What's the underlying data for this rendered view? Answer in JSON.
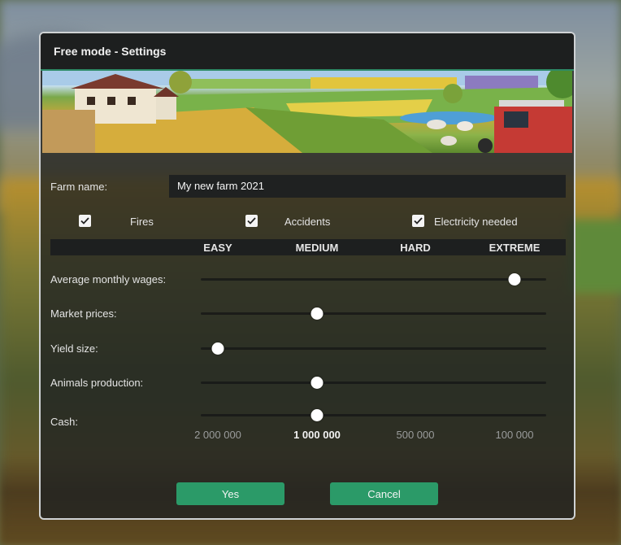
{
  "dialog": {
    "title": "Free mode - Settings"
  },
  "farm_name": {
    "label": "Farm name:",
    "value": "My new farm 2021"
  },
  "options": [
    {
      "label": "Fires",
      "checked": true
    },
    {
      "label": "Accidents",
      "checked": true
    },
    {
      "label": "Electricity needed",
      "checked": true
    }
  ],
  "difficulty_levels": [
    "EASY",
    "MEDIUM",
    "HARD",
    "EXTREME"
  ],
  "sliders": [
    {
      "label": "Average monthly wages:",
      "level_index": 3
    },
    {
      "label": "Market prices:",
      "level_index": 1
    },
    {
      "label": "Yield size:",
      "level_index": 0
    },
    {
      "label": "Animals production:",
      "level_index": 1
    },
    {
      "label": "Cash:",
      "level_index": 1
    }
  ],
  "cash_values": [
    "2 000 000",
    "1 000 000",
    "500 000",
    "100 000"
  ],
  "buttons": {
    "yes": "Yes",
    "cancel": "Cancel"
  },
  "colors": {
    "accent": "#2b9a68",
    "panel": "#202222",
    "titlebar": "#1d1f1f"
  }
}
